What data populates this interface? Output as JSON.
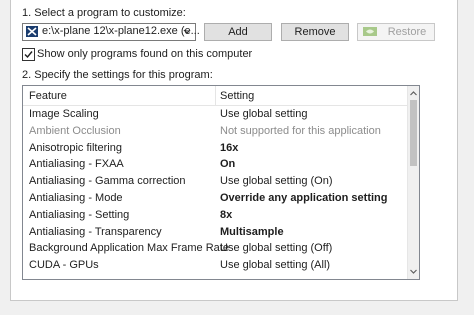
{
  "step1_label": "1. Select a program to customize:",
  "program_select": {
    "value": "e:\\x-plane 12\\x-plane12.exe (e..."
  },
  "buttons": {
    "add": "Add",
    "remove": "Remove",
    "restore": "Restore"
  },
  "show_only_checkbox": {
    "label": "Show only programs found on this computer",
    "checked": true
  },
  "step2_label": "2. Specify the settings for this program:",
  "table": {
    "headers": {
      "feature": "Feature",
      "setting": "Setting"
    },
    "rows": [
      {
        "feature": "Image Scaling",
        "setting": "Use global setting",
        "style": "normal"
      },
      {
        "feature": "Ambient Occlusion",
        "setting": "Not supported for this application",
        "style": "disabled"
      },
      {
        "feature": "Anisotropic filtering",
        "setting": "16x",
        "style": "bold"
      },
      {
        "feature": "Antialiasing - FXAA",
        "setting": "On",
        "style": "bold"
      },
      {
        "feature": "Antialiasing - Gamma correction",
        "setting": "Use global setting (On)",
        "style": "normal"
      },
      {
        "feature": "Antialiasing - Mode",
        "setting": "Override any application setting",
        "style": "bold"
      },
      {
        "feature": "Antialiasing - Setting",
        "setting": "8x",
        "style": "bold"
      },
      {
        "feature": "Antialiasing - Transparency",
        "setting": "Multisample",
        "style": "bold"
      },
      {
        "feature": "Background Application Max Frame Rate",
        "setting": "Use global setting (Off)",
        "style": "normal"
      },
      {
        "feature": "CUDA - GPUs",
        "setting": "Use global setting (All)",
        "style": "normal"
      }
    ]
  },
  "colors": {
    "nvidia_green": "#76b900",
    "disabled_text": "#8c8c8c",
    "checkmark": "#1e1e1e"
  },
  "icons": {
    "program": "xplane-program-icon",
    "dropdown": "chevron-down-icon",
    "restore": "nvidia-logo-icon"
  }
}
